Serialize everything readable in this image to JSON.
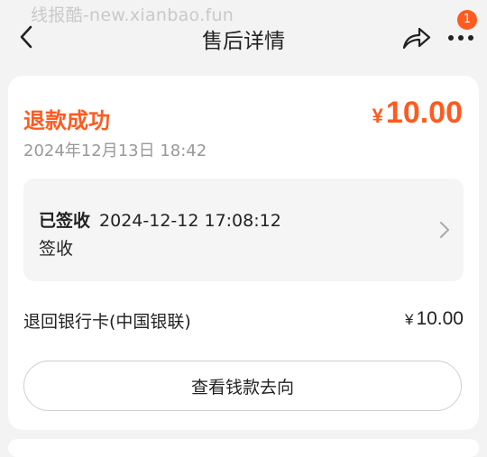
{
  "watermark": "线报酷-new.xianbao.fun",
  "header": {
    "title": "售后详情",
    "back_icon": "chevron-left-icon",
    "share_icon": "share-icon",
    "more_icon": "more-icon",
    "badge_count": "1"
  },
  "refund": {
    "status": "退款成功",
    "currency": "¥",
    "amount": "10.00",
    "datetime": "2024年12月13日 18:42"
  },
  "logistics": {
    "status": "已签收",
    "time": "2024-12-12 17:08:12",
    "description": "签收"
  },
  "refund_method": {
    "label": "退回银行卡(中国银联)",
    "currency": "¥",
    "amount": "10.00"
  },
  "actions": {
    "track_label": "查看钱款去向"
  },
  "colors": {
    "accent": "#ff5a1f",
    "background": "#f3f3f3"
  }
}
